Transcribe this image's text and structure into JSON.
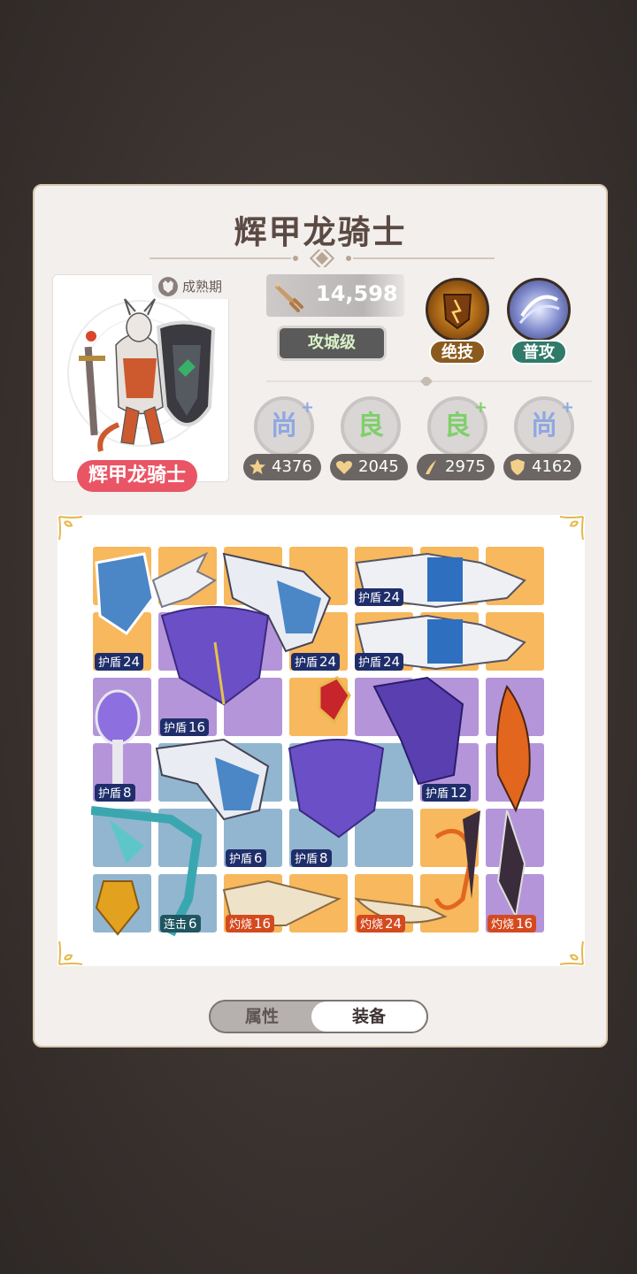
{
  "hero": {
    "title": "辉甲龙骑士",
    "name": "辉甲龙骑士",
    "stage": "成熟期",
    "power": "14,598",
    "rank": "攻城级"
  },
  "skills": [
    {
      "label": "绝技",
      "color": "#8a5a1f"
    },
    {
      "label": "普攻",
      "color": "#2f7a68"
    }
  ],
  "grades": [
    {
      "grade": "尚",
      "plus": "+",
      "color": "#8fa8e0"
    },
    {
      "grade": "良",
      "plus": "",
      "color": "#7fcf6a"
    },
    {
      "grade": "良",
      "plus": "+",
      "color": "#7fcf6a"
    },
    {
      "grade": "尚",
      "plus": "+",
      "color": "#8fa8e0"
    }
  ],
  "stats": [
    {
      "icon": "star-icon",
      "value": "4376"
    },
    {
      "icon": "heart-icon",
      "value": "2045"
    },
    {
      "icon": "claw-icon",
      "value": "2975"
    },
    {
      "icon": "shield-icon",
      "value": "4162"
    }
  ],
  "equipment_tags": [
    {
      "type": "护盾",
      "value": "24"
    },
    {
      "type": "护盾",
      "value": "24"
    },
    {
      "type": "护盾",
      "value": "24"
    },
    {
      "type": "护盾",
      "value": "24"
    },
    {
      "type": "护盾",
      "value": "16"
    },
    {
      "type": "护盾",
      "value": "8"
    },
    {
      "type": "护盾",
      "value": "12"
    },
    {
      "type": "护盾",
      "value": "6"
    },
    {
      "type": "护盾",
      "value": "8"
    },
    {
      "type": "连击",
      "value": "6"
    },
    {
      "type": "灼烧",
      "value": "16"
    },
    {
      "type": "灼烧",
      "value": "24"
    },
    {
      "type": "灼烧",
      "value": "16"
    }
  ],
  "tabs": {
    "attributes": "属性",
    "equipment": "装备"
  }
}
